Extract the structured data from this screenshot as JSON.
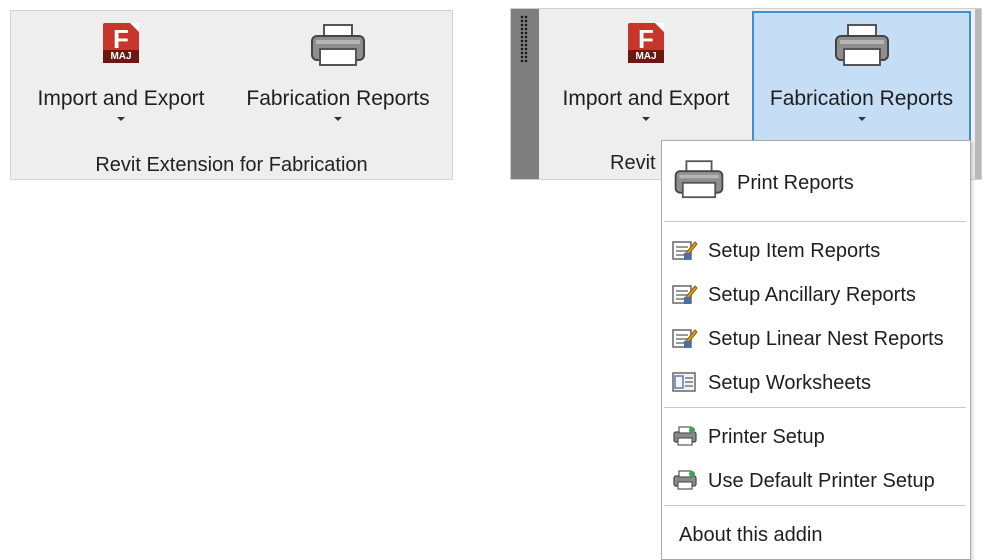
{
  "panel_left": {
    "import_export_label": "Import and Export",
    "fabrication_reports_label": "Fabrication Reports",
    "panel_title": "Revit Extension for Fabrication",
    "logo_letter": "F",
    "logo_band": "MAJ"
  },
  "panel_right": {
    "import_export_label": "Import and Export",
    "fabrication_reports_label": "Fabrication Reports",
    "panel_title_visible": "Revit",
    "logo_letter": "F",
    "logo_band": "MAJ"
  },
  "menu": {
    "print_reports": "Print Reports",
    "setup_item_reports": "Setup Item Reports",
    "setup_ancillary_reports": "Setup Ancillary Reports",
    "setup_linear_nest_reports": "Setup Linear Nest Reports",
    "setup_worksheets": "Setup Worksheets",
    "printer_setup": "Printer Setup",
    "use_default_printer_setup": "Use Default Printer Setup",
    "about": "About this addin"
  },
  "colors": {
    "logo_red": "#c8352a",
    "pressed_bg": "#c6def5",
    "pressed_border": "#3e8ed6"
  }
}
